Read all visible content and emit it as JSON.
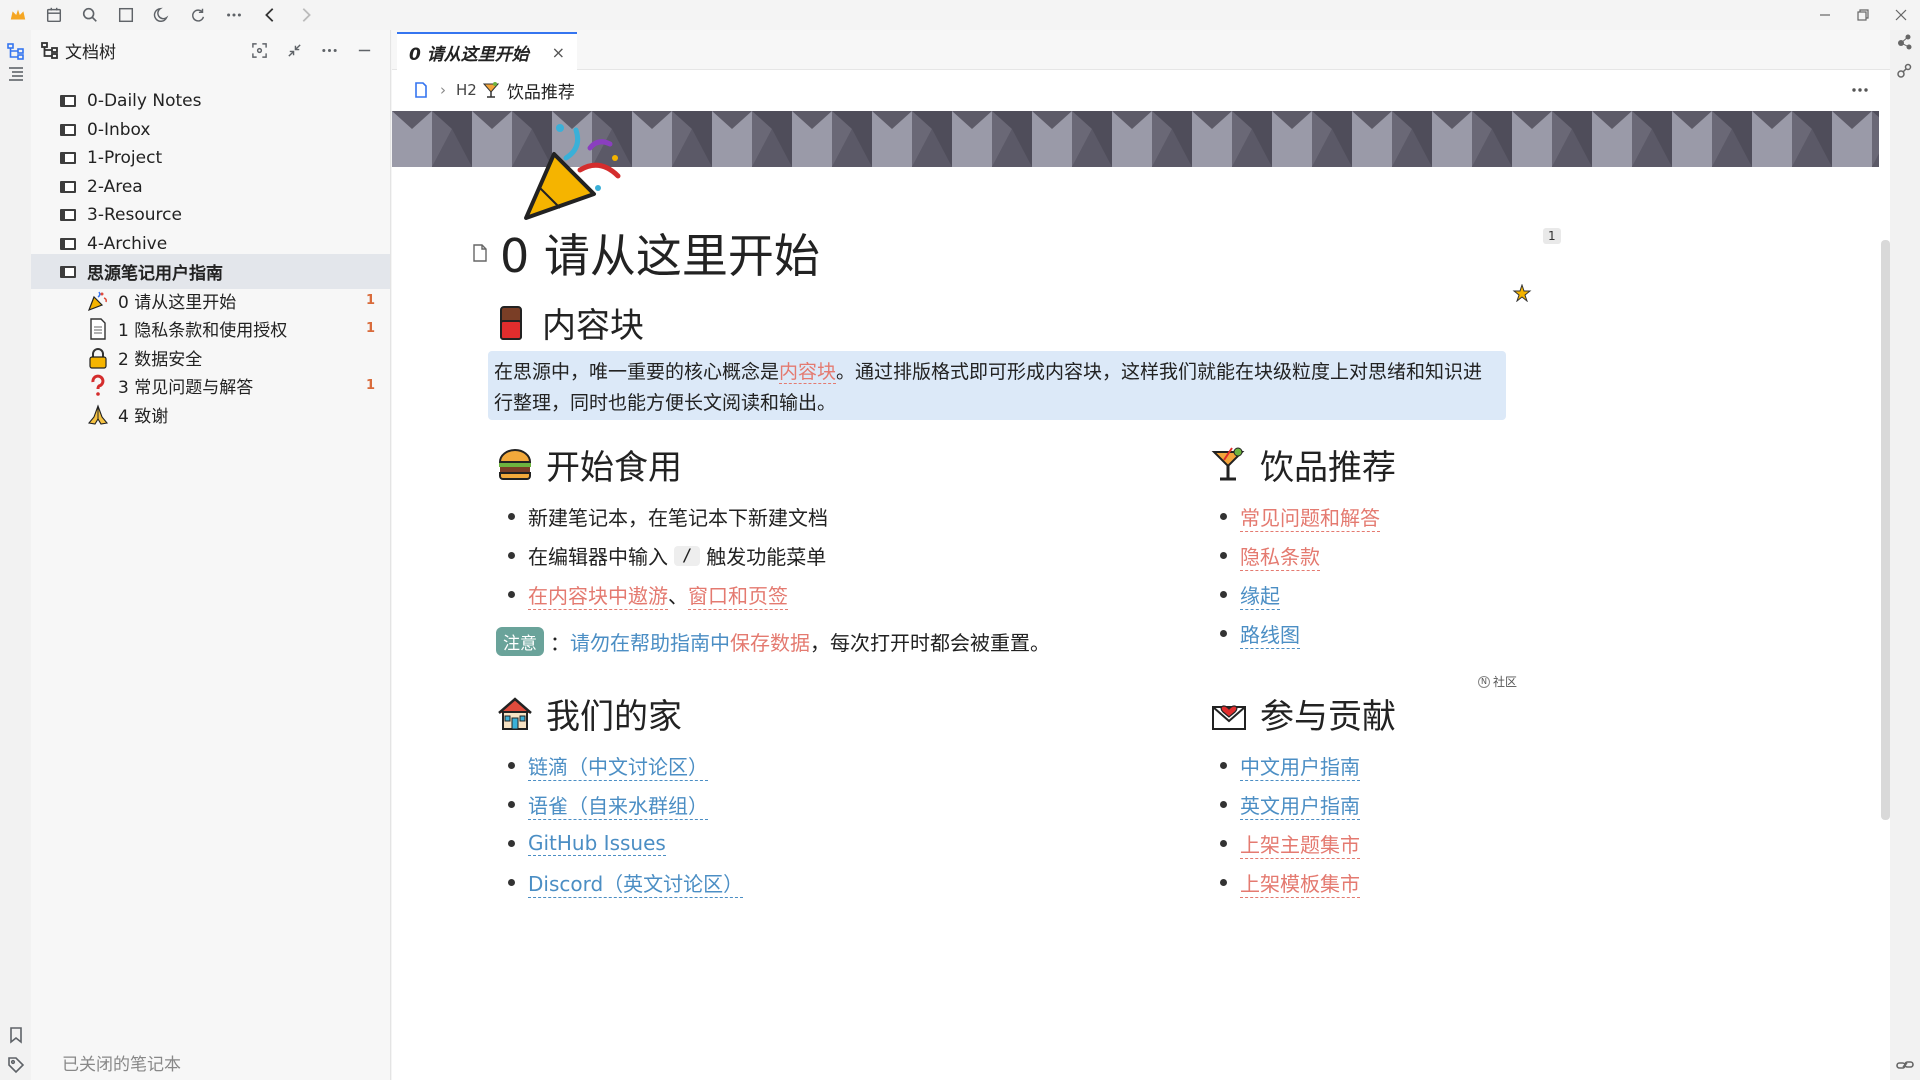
{
  "topbar": {
    "icons": [
      "crown-icon",
      "calendar-icon",
      "search-icon",
      "window-icon",
      "moon-icon",
      "sync-icon",
      "more-icon",
      "back-icon",
      "forward-icon"
    ]
  },
  "sidebar": {
    "title": "文档树",
    "notebooks": [
      {
        "label": "0-Daily Notes"
      },
      {
        "label": "0-Inbox"
      },
      {
        "label": "1-Project"
      },
      {
        "label": "2-Area"
      },
      {
        "label": "3-Resource"
      },
      {
        "label": "4-Archive"
      },
      {
        "label": "思源笔记用户指南"
      }
    ],
    "docs": [
      {
        "label": "0 请从这里开始",
        "count": "1"
      },
      {
        "label": "1 隐私条款和使用授权",
        "count": "1"
      },
      {
        "label": "2 数据安全",
        "count": ""
      },
      {
        "label": "3 常见问题与解答",
        "count": "1"
      },
      {
        "label": "4 致谢",
        "count": ""
      }
    ],
    "closed_notebooks": "已关闭的笔记本"
  },
  "tab": {
    "label": "0 请从这里开始",
    "close": "×"
  },
  "breadcrumb": {
    "heading_level": "H2",
    "label": "饮品推荐"
  },
  "document": {
    "title": "0 请从这里开始",
    "ref_count": "1",
    "sections": {
      "content_block": {
        "heading": "内容块"
      },
      "start": {
        "heading": "开始食用"
      },
      "drinks": {
        "heading": "饮品推荐"
      },
      "home": {
        "heading": "我们的家"
      },
      "contribute": {
        "heading": "参与贡献"
      }
    },
    "callout": {
      "before": "在思源中，唯一重要的核心概念是",
      "link": "内容块",
      "after": "。通过排版格式即可形成内容块，这样我们就能在块级粒度上对思绪和知识进行整理，同时也能方便长文阅读和输出。"
    },
    "start_list": {
      "item1": "新建笔记本，在笔记本下新建文档",
      "item2_before": "在编辑器中输入",
      "item2_kbd": "/",
      "item2_after": "触发功能菜单",
      "item3_link1": "在内容块中遨游",
      "item3_sep": "、",
      "item3_link2": "窗口和页签"
    },
    "note": {
      "badge": "注意",
      "colon": "：",
      "link_part1": "请勿在帮助指南中",
      "link_part2": "保存数据",
      "rest": "，每次打开时都会被重置。"
    },
    "drinks_list": [
      "常见问题和解答",
      "隐私条款",
      "缘起",
      "路线图"
    ],
    "community_label": "社区",
    "home_list": [
      "链滴（中文讨论区）",
      "语雀（自来水群组）",
      "GitHub Issues",
      "Discord（英文讨论区）"
    ],
    "contribute_list": [
      "中文用户指南",
      "英文用户指南",
      "上架主题集市",
      "上架模板集市"
    ]
  },
  "colors": {
    "accent": "#3575f0",
    "link_red": "#e47a70",
    "link_blue": "#4b8ec4",
    "callout_bg": "#dce9f8",
    "note_badge": "#6aa39a",
    "count": "#d96b3b"
  }
}
